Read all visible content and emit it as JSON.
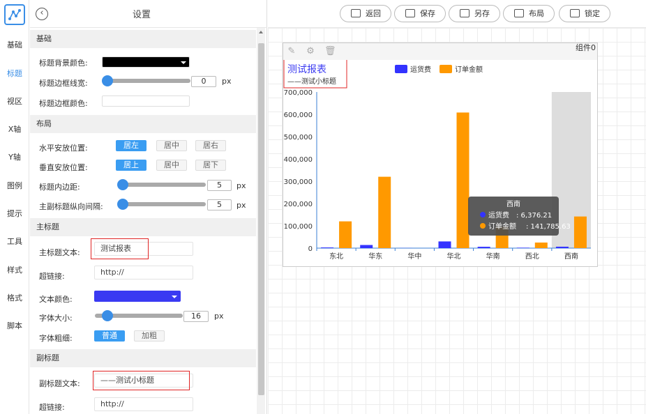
{
  "sidebar": {
    "items": [
      {
        "label": "基础",
        "active": false
      },
      {
        "label": "标题",
        "active": true
      },
      {
        "label": "视区",
        "active": false
      },
      {
        "label": "X轴",
        "active": false
      },
      {
        "label": "Y轴",
        "active": false
      },
      {
        "label": "图例",
        "active": false
      },
      {
        "label": "提示",
        "active": false
      },
      {
        "label": "工具",
        "active": false
      },
      {
        "label": "样式",
        "active": false
      },
      {
        "label": "格式",
        "active": false
      },
      {
        "label": "脚本",
        "active": false
      }
    ]
  },
  "panel": {
    "title": "设置",
    "basic": {
      "section": "基础",
      "bg_color_label": "标题背景颜色:",
      "bg_color": "#000000",
      "border_width_label": "标题边框线宽:",
      "border_width_value": "0",
      "border_width_unit": "px",
      "border_color_label": "标题边框颜色:"
    },
    "layout": {
      "section": "布局",
      "h_label": "水平安放位置:",
      "h_options": [
        "居左",
        "居中",
        "居右"
      ],
      "h_selected": "居左",
      "v_label": "垂直安放位置:",
      "v_options": [
        "居上",
        "居中",
        "居下"
      ],
      "v_selected": "居上",
      "padding_label": "标题内边距:",
      "padding_value": "5",
      "padding_unit": "px",
      "gap_label": "主副标题纵向间隔:",
      "gap_value": "5",
      "gap_unit": "px"
    },
    "main_title": {
      "section": "主标题",
      "text_label": "主标题文本:",
      "text_value": "测试报表",
      "link_label": "超链接:",
      "link_value": "http://",
      "color_label": "文本颜色:",
      "color": "#3a3af2",
      "size_label": "字体大小:",
      "size_value": "16",
      "size_unit": "px",
      "weight_label": "字体粗细:",
      "weight_options": [
        "普通",
        "加粗"
      ],
      "weight_selected": "普通"
    },
    "sub_title": {
      "section": "副标题",
      "text_label": "副标题文本:",
      "text_value": "——测试小标题",
      "link_label": "超链接:",
      "link_value": "http://"
    }
  },
  "toolbar": {
    "buttons": [
      "返回",
      "保存",
      "另存",
      "布局",
      "锁定"
    ]
  },
  "widget": {
    "name": "组件0",
    "icons": [
      "edit-icon",
      "gear-icon",
      "trash-icon"
    ]
  },
  "chart_data": {
    "type": "bar",
    "title": "测试报表",
    "subtitle": "——测试小标题",
    "categories": [
      "东北",
      "华东",
      "华中",
      "华北",
      "华南",
      "西北",
      "西南"
    ],
    "series": [
      {
        "name": "运货费",
        "color": "#3333ff",
        "values": [
          3000,
          14000,
          500,
          30000,
          6000,
          2000,
          6376.21
        ]
      },
      {
        "name": "订单金额",
        "color": "#ff9900",
        "values": [
          120000,
          320000,
          0,
          608000,
          95000,
          25000,
          141785.63
        ]
      }
    ],
    "ylim": [
      0,
      700000
    ],
    "yticks": [
      "700,000",
      "600,000",
      "500,000",
      "400,000",
      "300,000",
      "200,000",
      "100,000",
      "0"
    ],
    "legend": "top",
    "highlighted_category": "西南",
    "tooltip": {
      "title": "西南",
      "rows": [
        {
          "name": "运货费",
          "value": "6,376.21",
          "color": "#3333ff"
        },
        {
          "name": "订单金额",
          "value": "141,785.63",
          "color": "#ff9900"
        }
      ]
    }
  }
}
